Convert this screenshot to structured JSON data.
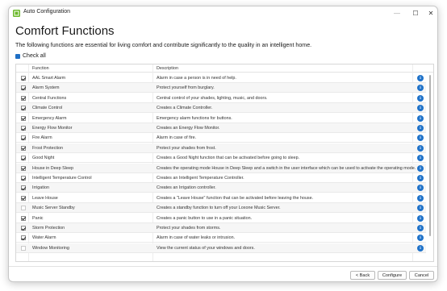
{
  "window": {
    "title": "Auto Configuration",
    "controls": {
      "minimize": "—",
      "maximize": "☐",
      "close": "✕"
    }
  },
  "page": {
    "heading": "Comfort Functions",
    "intro": "The following functions are essential for living comfort and contribute significantly to the quality in an intelligent home.",
    "check_all_label": "Check all",
    "check_all_checked": true
  },
  "table": {
    "headers": {
      "function": "Function",
      "description": "Description"
    },
    "rows": [
      {
        "checked": true,
        "function": "AAL Smart Alarm",
        "description": "Alarm in case a person is in need of help."
      },
      {
        "checked": true,
        "function": "Alarm System",
        "description": "Protect yourself from burglary."
      },
      {
        "checked": true,
        "function": "Central Functions",
        "description": "Central control of your shades, lighting, music, and doors."
      },
      {
        "checked": true,
        "function": "Climate Control",
        "description": "Creates a Climate Controller."
      },
      {
        "checked": true,
        "function": "Emergency Alarm",
        "description": "Emergency alarm functions for buttons."
      },
      {
        "checked": true,
        "function": "Energy Flow Monitor",
        "description": "Creates an Energy Flow Monitor."
      },
      {
        "checked": true,
        "function": "Fire Alarm",
        "description": "Alarm in case of fire."
      },
      {
        "checked": true,
        "function": "Frost Protection",
        "description": "Protect your shades from frost."
      },
      {
        "checked": true,
        "function": "Good Night",
        "description": "Creates a Good Night function that can be activated before going to sleep."
      },
      {
        "checked": true,
        "function": "House in Deep Sleep",
        "description": "Creates the operating mode House in Deep Sleep and a switch in the user interface which can be used to activate the operating mode."
      },
      {
        "checked": true,
        "function": "Intelligent Temperature Control",
        "description": "Creates an Intelligent Temperature Controller."
      },
      {
        "checked": true,
        "function": "Irrigation",
        "description": "Creates an Irrigation controller."
      },
      {
        "checked": true,
        "function": "Leave House",
        "description": "Creates a \"Leave House\" function that can be activated before leaving the house."
      },
      {
        "checked": false,
        "function": "Music Server Standby",
        "description": "Creates a standby function to turn off your Loxone Music Server."
      },
      {
        "checked": true,
        "function": "Panic",
        "description": "Creates a panic button to use in a panic situation."
      },
      {
        "checked": true,
        "function": "Storm Protection",
        "description": "Protect your shades from storms."
      },
      {
        "checked": true,
        "function": "Water Alarm",
        "description": "Alarm in case of water leaks or intrusion."
      },
      {
        "checked": false,
        "function": "Window Monitoring",
        "description": "View the current status of your windows and doors."
      }
    ],
    "info_icon": "i"
  },
  "footer": {
    "back_label": "< Back",
    "configure_label": "Configure",
    "cancel_label": "Cancel"
  },
  "colors": {
    "accent": "#1f6fc5",
    "info_icon": "#1f72c9",
    "row_alt": "#f6f6f6",
    "app_icon": "#6bb82a"
  }
}
